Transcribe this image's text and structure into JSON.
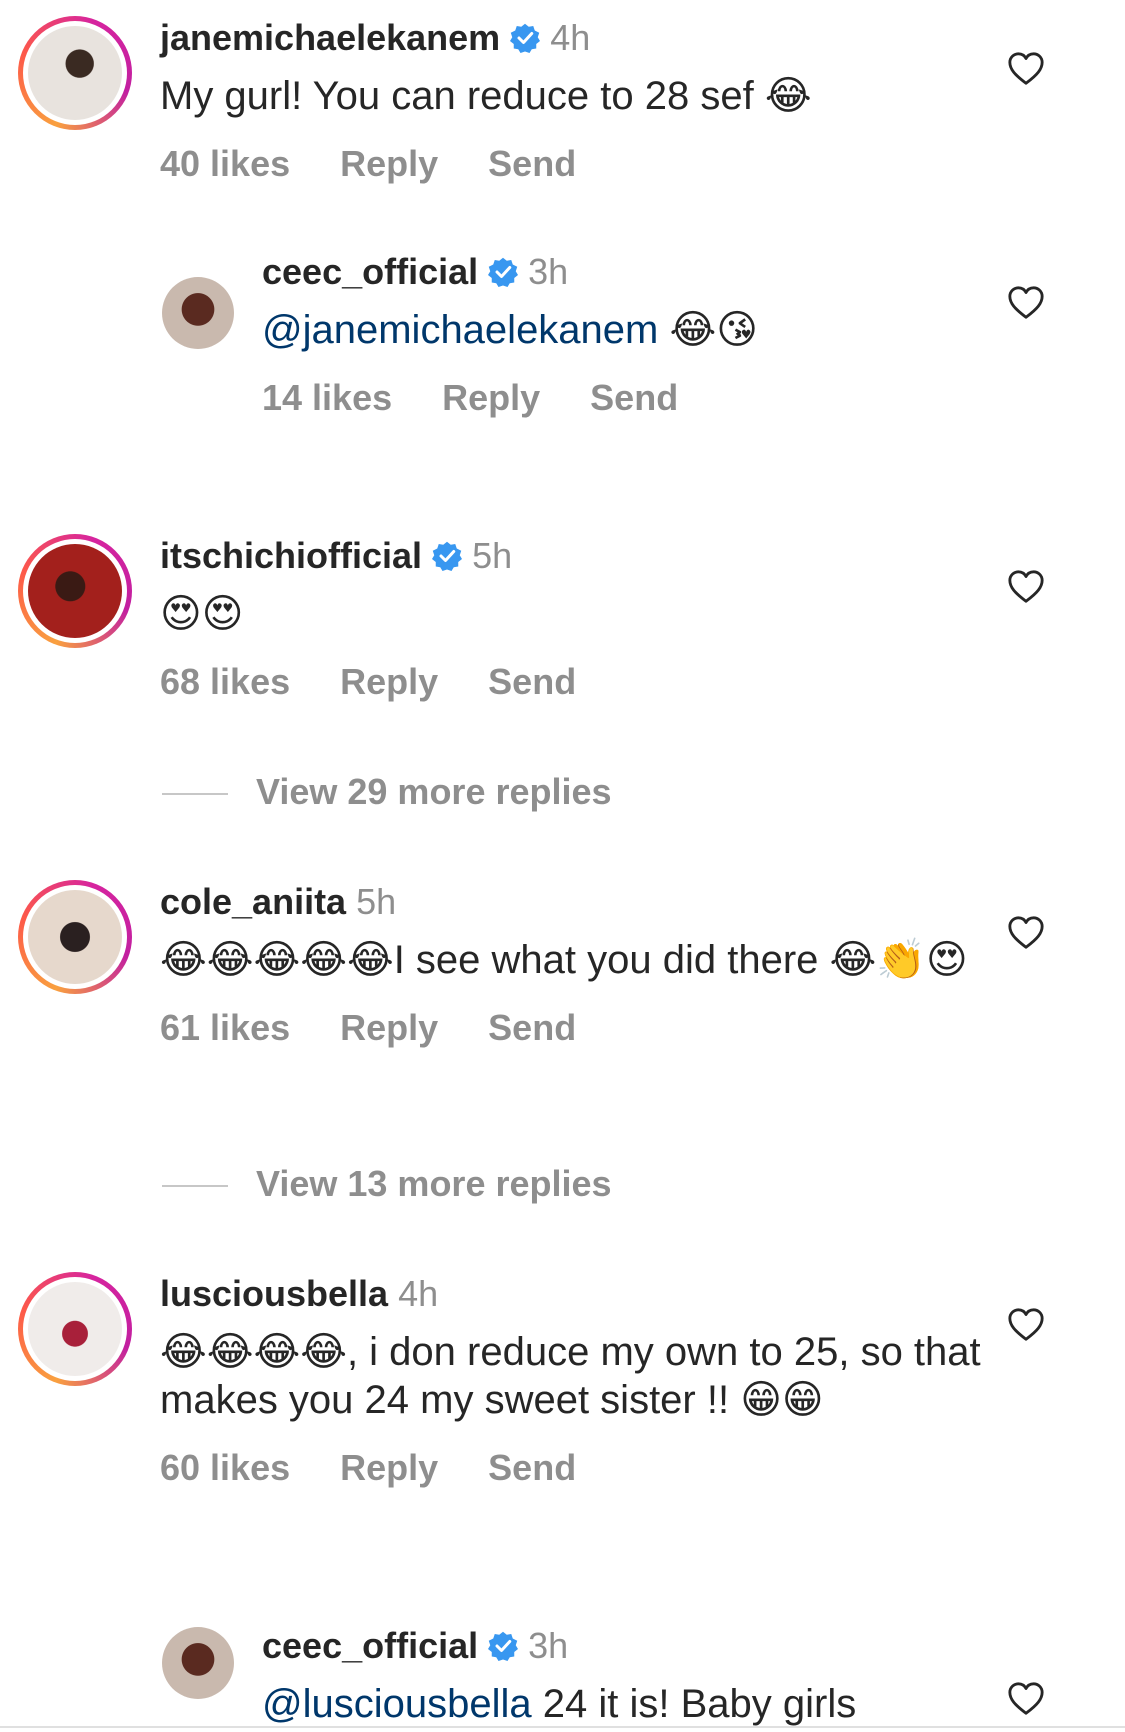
{
  "comments": [
    {
      "type": "main",
      "username": "janemichaelekanem",
      "verified": true,
      "time": "4h",
      "text": "My gurl! You can reduce to 28 sef 😂",
      "likes": "40 likes",
      "reply_label": "Reply",
      "send_label": "Send",
      "avatar_color": "#d9d4cf"
    },
    {
      "type": "reply",
      "username": "ceec_official",
      "verified": true,
      "time": "3h",
      "mention": "@janemichaelekanem",
      "text": " 😂😘",
      "likes": "14 likes",
      "reply_label": "Reply",
      "send_label": "Send",
      "avatar_color": "#8a4a3a"
    },
    {
      "type": "main",
      "username": "itschichiofficial",
      "verified": true,
      "time": "5h",
      "text": "😍😍",
      "likes": "68 likes",
      "reply_label": "Reply",
      "send_label": "Send",
      "avatar_color": "#9b1c1c"
    },
    {
      "type": "main",
      "username": "cole_aniita",
      "verified": false,
      "time": "5h",
      "text": "😂😂😂😂😂I see what you did there 😂👏😍",
      "likes": "61 likes",
      "reply_label": "Reply",
      "send_label": "Send",
      "avatar_color": "#c9a27c"
    },
    {
      "type": "main",
      "username": "lusciousbella",
      "verified": false,
      "time": "4h",
      "text": "😂😂😂😂, i don reduce my own to 25, so that makes you 24 my sweet sister !! 😁😁",
      "likes": "60 likes",
      "reply_label": "Reply",
      "send_label": "Send",
      "avatar_color": "#b3243a"
    },
    {
      "type": "reply",
      "username": "ceec_official",
      "verified": true,
      "time": "3h",
      "mention": "@lusciousbella",
      "text": " 24 it is! Baby girls",
      "avatar_color": "#8a4a3a"
    }
  ],
  "view_more": [
    {
      "label": "View 29 more replies"
    },
    {
      "label": "View 13 more replies"
    }
  ],
  "colors": {
    "verified": "#3897f0",
    "mention": "#00376b",
    "secondary_text": "#8e8e8e"
  }
}
